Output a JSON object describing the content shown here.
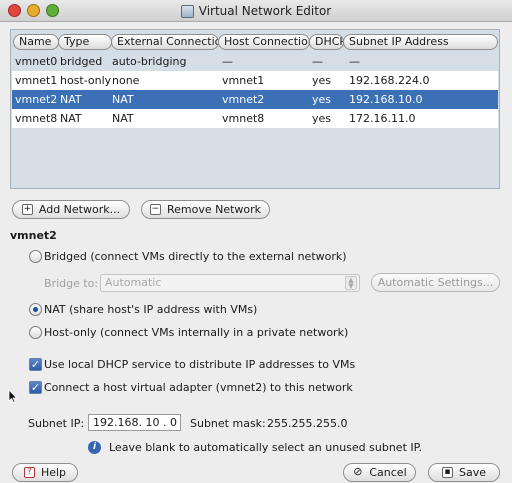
{
  "window": {
    "title": "Virtual Network Editor",
    "traffic_lights": {
      "close": "#e2463f",
      "minimize": "#e6ad2b",
      "maximize": "#5fae3a"
    }
  },
  "table": {
    "headers": [
      "Name",
      "Type",
      "External Connection",
      "Host Connection",
      "DHCP",
      "Subnet IP Address"
    ],
    "rows": [
      {
        "name": "vmnet0",
        "type": "bridged",
        "external": "auto-bridging",
        "host": "—",
        "dhcp": "—",
        "subnet": "—",
        "selected": false
      },
      {
        "name": "vmnet1",
        "type": "host-only",
        "external": "none",
        "host": "vmnet1",
        "dhcp": "yes",
        "subnet": "192.168.224.0",
        "selected": false
      },
      {
        "name": "vmnet2",
        "type": "NAT",
        "external": "NAT",
        "host": "vmnet2",
        "dhcp": "yes",
        "subnet": "192.168.10.0",
        "selected": true
      },
      {
        "name": "vmnet8",
        "type": "NAT",
        "external": "NAT",
        "host": "vmnet8",
        "dhcp": "yes",
        "subnet": "172.16.11.0",
        "selected": false
      }
    ],
    "selection_color": "#3b6fb6"
  },
  "actions": {
    "add_network": "Add Network...",
    "remove_network": "Remove Network"
  },
  "section": {
    "title": "vmnet2",
    "bridged_label": "Bridged (connect VMs directly to the external network)",
    "bridge_to_label": "Bridge to:",
    "bridge_to_value": "Automatic",
    "automatic_settings": "Automatic Settings...",
    "nat_label": "NAT (share host's IP address with VMs)",
    "host_only_label": "Host-only (connect VMs internally in a private network)",
    "selected_mode": "nat",
    "dhcp_label": "Use local DHCP service to distribute IP addresses to VMs",
    "dhcp_checked": true,
    "adapter_label": "Connect a host virtual adapter (vmnet2) to this network",
    "adapter_checked": true
  },
  "subnet": {
    "ip_label": "Subnet IP:",
    "ip_value": "192.168. 10 .  0",
    "mask_label": "Subnet mask:",
    "mask_value": "255.255.255.0",
    "hint": "Leave blank to automatically select an unused subnet IP."
  },
  "footer": {
    "help": "Help",
    "cancel": "Cancel",
    "save": "Save"
  }
}
